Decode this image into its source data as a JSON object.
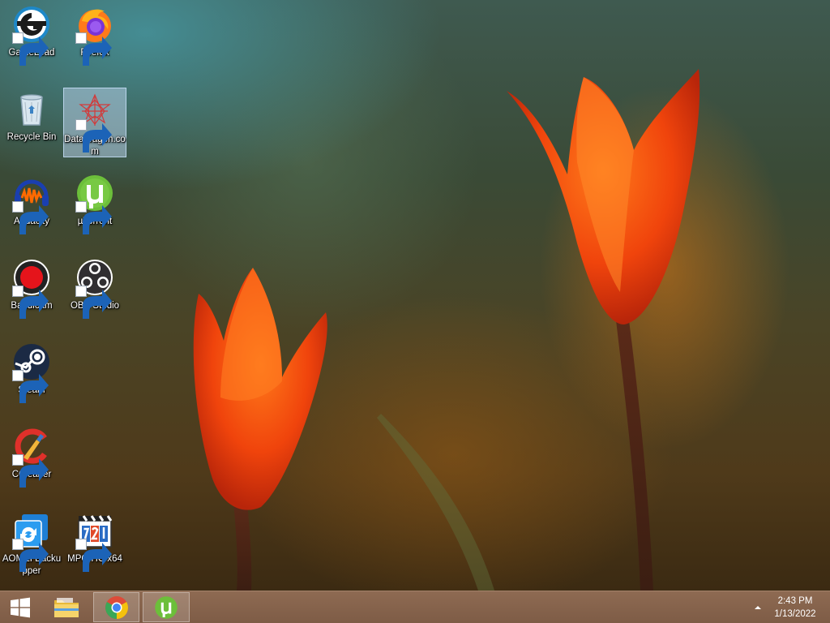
{
  "desktop": {
    "icons": [
      {
        "label": "GameLoad",
        "icon": "gameload-icon",
        "selected": false
      },
      {
        "label": "Firefox",
        "icon": "firefox-icon",
        "selected": false
      },
      {
        "label": "Recycle Bin",
        "icon": "recycle-bin-icon",
        "selected": false
      },
      {
        "label": "DataWagon.com",
        "icon": "datawagon-icon",
        "selected": true
      },
      {
        "label": "Audacity",
        "icon": "audacity-icon",
        "selected": false
      },
      {
        "label": "µTorrent",
        "icon": "utorrent-icon",
        "selected": false
      },
      {
        "label": "Bandicam",
        "icon": "bandicam-icon",
        "selected": false
      },
      {
        "label": "OBS Studio",
        "icon": "obs-studio-icon",
        "selected": false
      },
      {
        "label": "Steam",
        "icon": "steam-icon",
        "selected": false
      },
      {
        "label": "CCleaner",
        "icon": "ccleaner-icon",
        "selected": false
      },
      {
        "label": "AOMEI Backupper",
        "icon": "aomei-backupper-icon",
        "selected": false
      },
      {
        "label": "MPC-HC x64",
        "icon": "mpc-hc-icon",
        "selected": false
      }
    ]
  },
  "taskbar": {
    "start_icon": "windows-start-icon",
    "pinned": [
      {
        "icon": "file-explorer-icon",
        "active": false
      },
      {
        "icon": "chrome-icon",
        "active": true
      },
      {
        "icon": "utorrent-icon",
        "active": true
      }
    ],
    "tray_chevron": "show-hidden-icons-chevron",
    "clock": {
      "time": "2:43 PM",
      "date": "1/13/2022"
    }
  },
  "colors": {
    "taskbar": "#8e6a52",
    "selection": "#b4cde6"
  }
}
